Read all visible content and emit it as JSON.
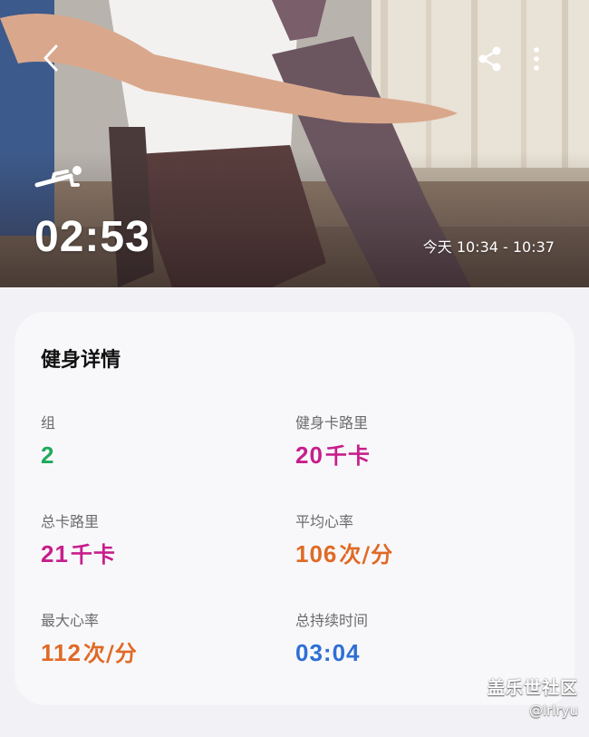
{
  "header": {
    "duration": "02:53",
    "time_range": "今天 10:34 - 10:37",
    "icons": {
      "back": "back-arrow-icon",
      "share": "share-icon",
      "more": "more-vertical-icon",
      "exercise": "plank-exercise-icon"
    }
  },
  "details": {
    "title": "健身详情",
    "stats": [
      {
        "label": "组",
        "value": "2",
        "unit": "",
        "color": "#1faa5a"
      },
      {
        "label": "健身卡路里",
        "value": "20",
        "unit": "千卡",
        "color": "#c81e8c"
      },
      {
        "label": "总卡路里",
        "value": "21",
        "unit": "千卡",
        "color": "#c81e8c"
      },
      {
        "label": "平均心率",
        "value": "106",
        "unit": "次/分",
        "color": "#e06a25"
      },
      {
        "label": "最大心率",
        "value": "112",
        "unit": "次/分",
        "color": "#e06a25"
      },
      {
        "label": "总持续时间",
        "value": "03:04",
        "unit": "",
        "color": "#2f6fd4"
      }
    ]
  },
  "watermark": {
    "title": "盖乐世社区",
    "user": "@lrlryu"
  }
}
